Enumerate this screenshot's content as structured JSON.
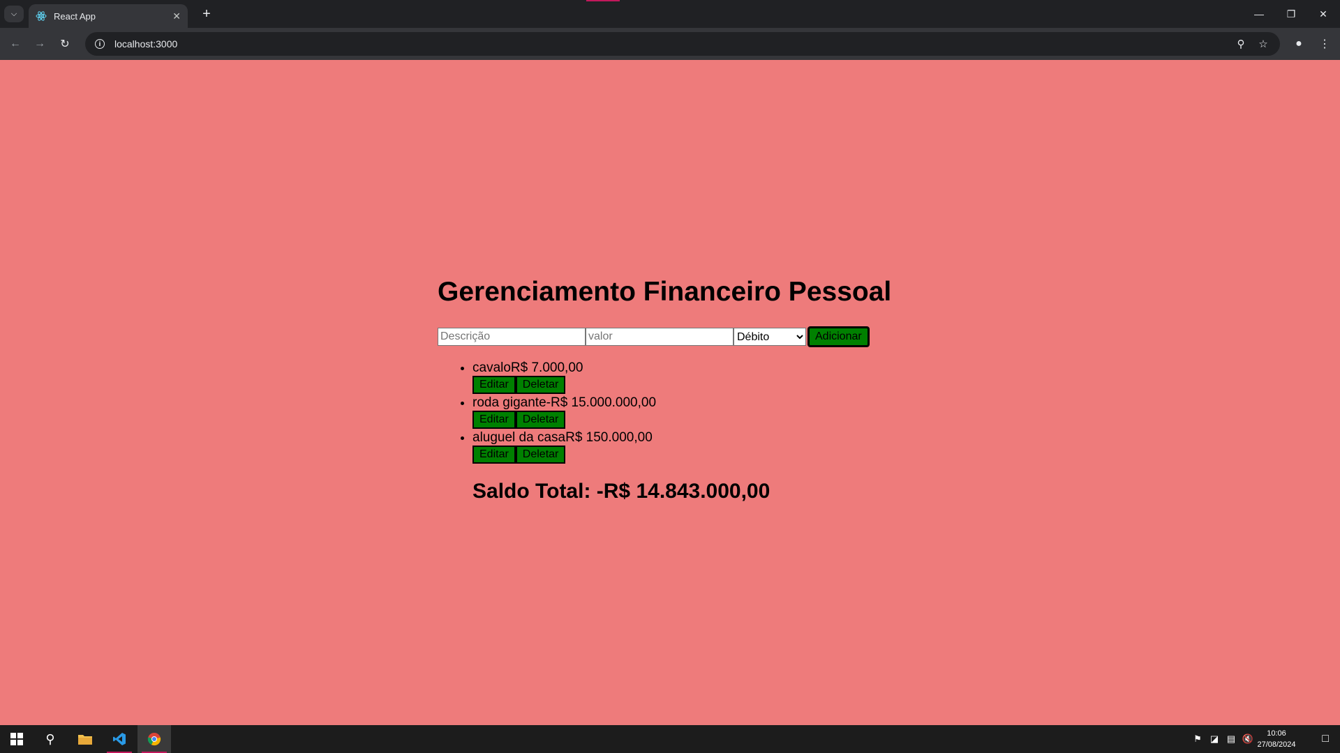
{
  "browser": {
    "tab": {
      "title": "React App"
    },
    "address": "localhost:3000"
  },
  "app": {
    "title": "Gerenciamento Financeiro Pessoal",
    "form": {
      "description_placeholder": "Descrição",
      "value_placeholder": "valor",
      "type_selected": "Débito",
      "add_label": "Adicionar"
    },
    "transactions": [
      {
        "text": "cavaloR$ 7.000,00",
        "edit_label": "Editar",
        "delete_label": "Deletar"
      },
      {
        "text": "roda gigante-R$ 15.000.000,00",
        "edit_label": "Editar",
        "delete_label": "Deletar"
      },
      {
        "text": "aluguel da casaR$ 150.000,00",
        "edit_label": "Editar",
        "delete_label": "Deletar"
      }
    ],
    "total": "Saldo Total: -R$ 14.843.000,00"
  },
  "taskbar": {
    "time": "10:06",
    "date": "27/08/2024"
  },
  "colors": {
    "page_background": "#ee7b7b",
    "button_green": "#008000",
    "accent": "#c2185b"
  }
}
